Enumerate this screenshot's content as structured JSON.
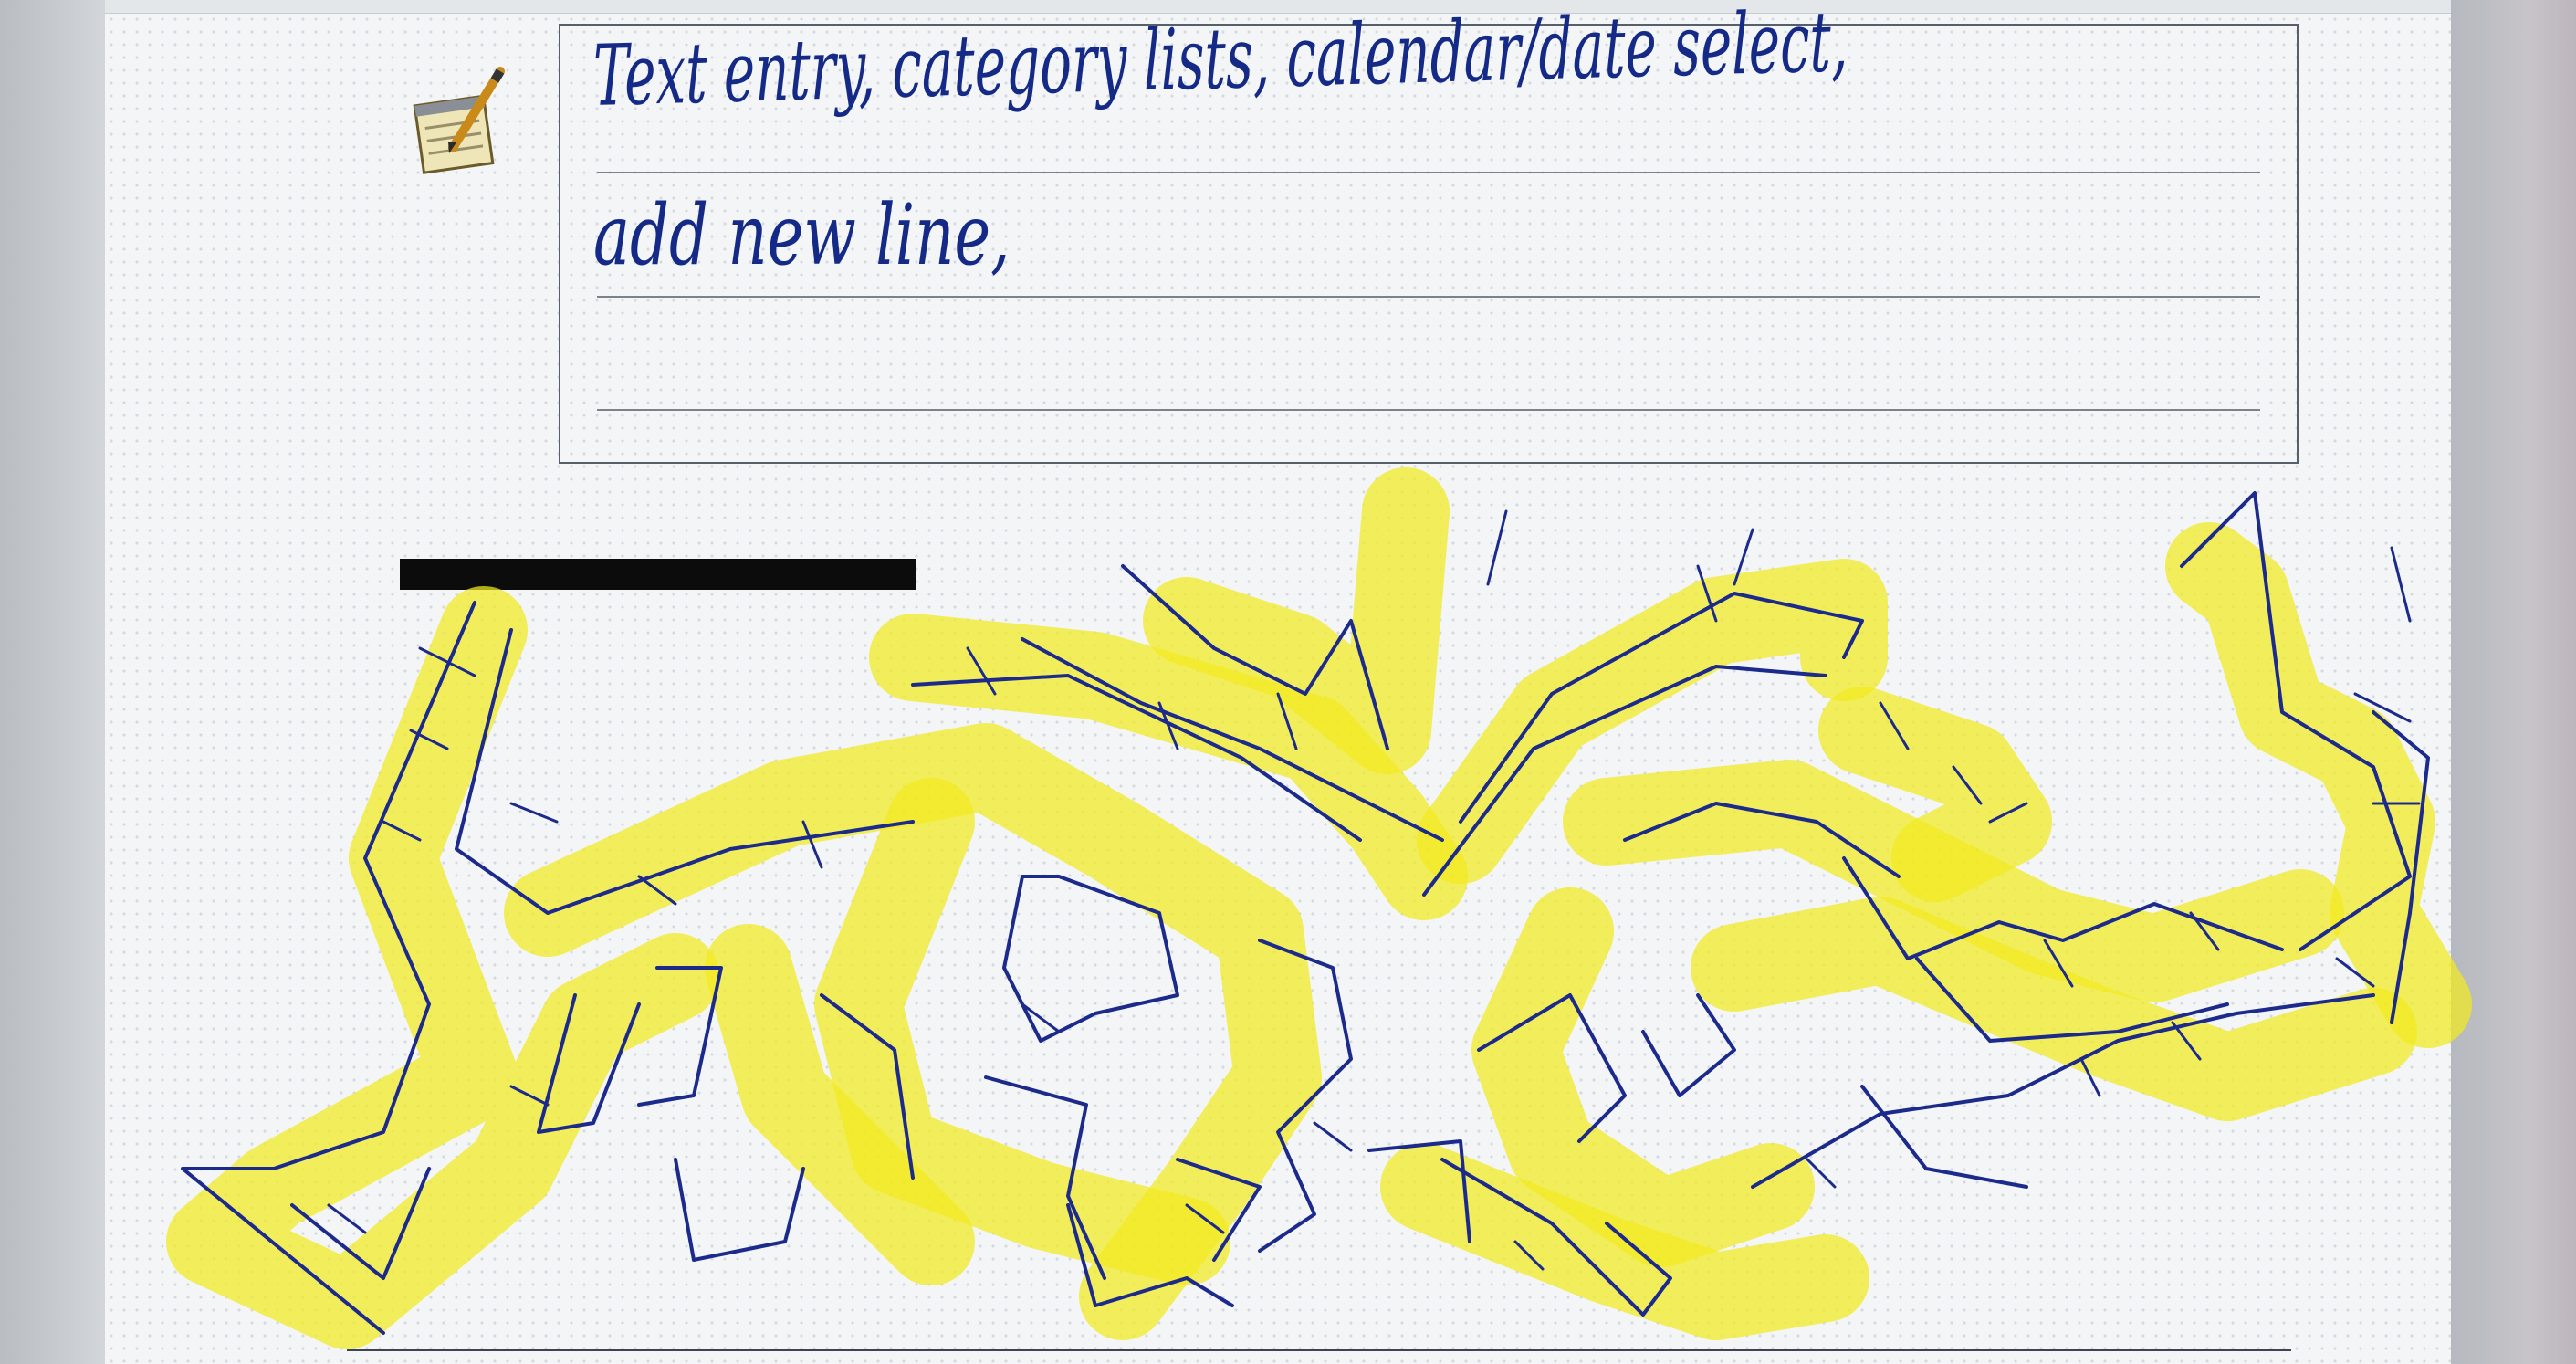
{
  "notes": {
    "line1": "Text entry, category lists, calendar/date select,",
    "line2": "add new line,"
  },
  "colors": {
    "ink": "#152a86",
    "highlighter": "#f1ea1f",
    "redaction": "#0c0c0c"
  },
  "icons": {
    "notes": "notepad-pencil-icon"
  }
}
